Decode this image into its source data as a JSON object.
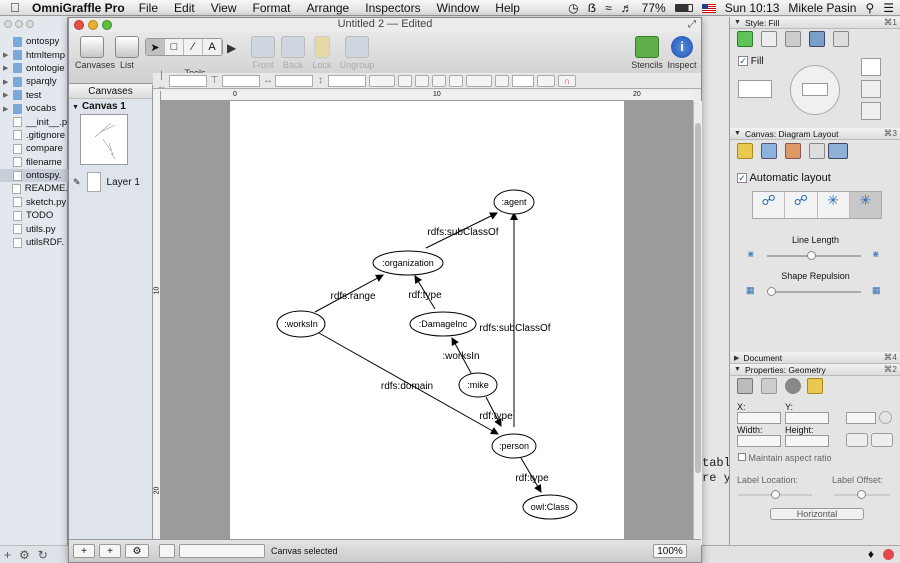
{
  "menubar": {
    "app_name": "OmniGraffle Pro",
    "items": [
      "File",
      "Edit",
      "View",
      "Format",
      "Arrange",
      "Inspectors",
      "Window",
      "Help"
    ],
    "battery": "77%",
    "clock": "Sun 10:13",
    "user": "Mikele Pasin"
  },
  "sidebar": {
    "files": [
      {
        "name": "ontospy",
        "type": "folder",
        "expander": "none",
        "selected": false
      },
      {
        "name": "htmltemp",
        "type": "folder",
        "expander": "closed",
        "selected": false
      },
      {
        "name": "ontologie",
        "type": "folder",
        "expander": "closed",
        "selected": false
      },
      {
        "name": "sparqly",
        "type": "folder",
        "expander": "closed",
        "selected": false
      },
      {
        "name": "test",
        "type": "folder",
        "expander": "closed",
        "selected": false
      },
      {
        "name": "vocabs",
        "type": "folder",
        "expander": "closed",
        "selected": false
      },
      {
        "name": "__init__.p",
        "type": "doc",
        "expander": "none",
        "selected": false
      },
      {
        "name": ".gitignore",
        "type": "doc",
        "expander": "none",
        "selected": false
      },
      {
        "name": "compare",
        "type": "doc",
        "expander": "none",
        "selected": false
      },
      {
        "name": "filename",
        "type": "doc",
        "expander": "none",
        "selected": false
      },
      {
        "name": "ontospy.",
        "type": "doc",
        "expander": "none",
        "selected": true
      },
      {
        "name": "README.",
        "type": "doc",
        "expander": "none",
        "selected": false
      },
      {
        "name": "sketch.py",
        "type": "doc",
        "expander": "none",
        "selected": false
      },
      {
        "name": "TODO",
        "type": "doc",
        "expander": "none",
        "selected": false
      },
      {
        "name": "utils.py",
        "type": "doc",
        "expander": "none",
        "selected": false
      },
      {
        "name": "utilsRDF.",
        "type": "doc",
        "expander": "none",
        "selected": false
      }
    ]
  },
  "window": {
    "title": "Untitled 2 — Edited",
    "toolbar": {
      "canvases": "Canvases",
      "list": "List",
      "tools": "Tools",
      "front": "Front",
      "back": "Back",
      "lock": "Lock",
      "ungroup": "Ungroup",
      "stencils": "Stencils",
      "inspect": "Inspect"
    },
    "canvases_panel": {
      "header": "Canvases",
      "canvas_name": "Canvas 1",
      "layer_name": "Layer 1"
    },
    "ruler": {
      "top": [
        "0",
        "10",
        "20"
      ],
      "left": [
        "10",
        "20"
      ]
    },
    "status": "Canvas selected",
    "zoom": "100%"
  },
  "diagram": {
    "nodes": [
      {
        "id": "agent",
        "label": ":agent"
      },
      {
        "id": "organization",
        "label": ":organization"
      },
      {
        "id": "worksIn",
        "label": ":worksIn"
      },
      {
        "id": "damage",
        "label": ":DamageInc"
      },
      {
        "id": "mike",
        "label": ":mike"
      },
      {
        "id": "person",
        "label": ":person"
      },
      {
        "id": "owlclass",
        "label": "owl:Class"
      }
    ],
    "edge_labels": {
      "org_agent": "rdfs:subClassOf",
      "worksin_org": "rdfs:range",
      "damage_org": "rdf:type",
      "person_agent": "rdfs:subClassOf",
      "mike_damage": ":worksIn",
      "worksin_person": "rdfs:domain",
      "mike_person": "rdf:type",
      "person_class": "rdf:type"
    }
  },
  "inspector": {
    "style_header": "Style: Fill",
    "style_key": "⌘1",
    "fill_label": "Fill",
    "layout_header": "Canvas: Diagram Layout",
    "layout_key": "⌘3",
    "auto_layout": "Automatic layout",
    "line_length": "Line Length",
    "shape_repulsion": "Shape Repulsion",
    "document_header": "Document",
    "document_key": "⌘4",
    "geometry_header": "Properties: Geometry",
    "geometry_key": "⌘2",
    "x_label": "X:",
    "y_label": "Y:",
    "width_label": "Width:",
    "height_label": "Height:",
    "aspect_label": "Maintain aspect ratio",
    "label_location": "Label Location:",
    "label_offset": "Label Offset:",
    "orientation": "Horizontal"
  },
  "background_terminal": {
    "line1": "table",
    "line2": "re y"
  }
}
